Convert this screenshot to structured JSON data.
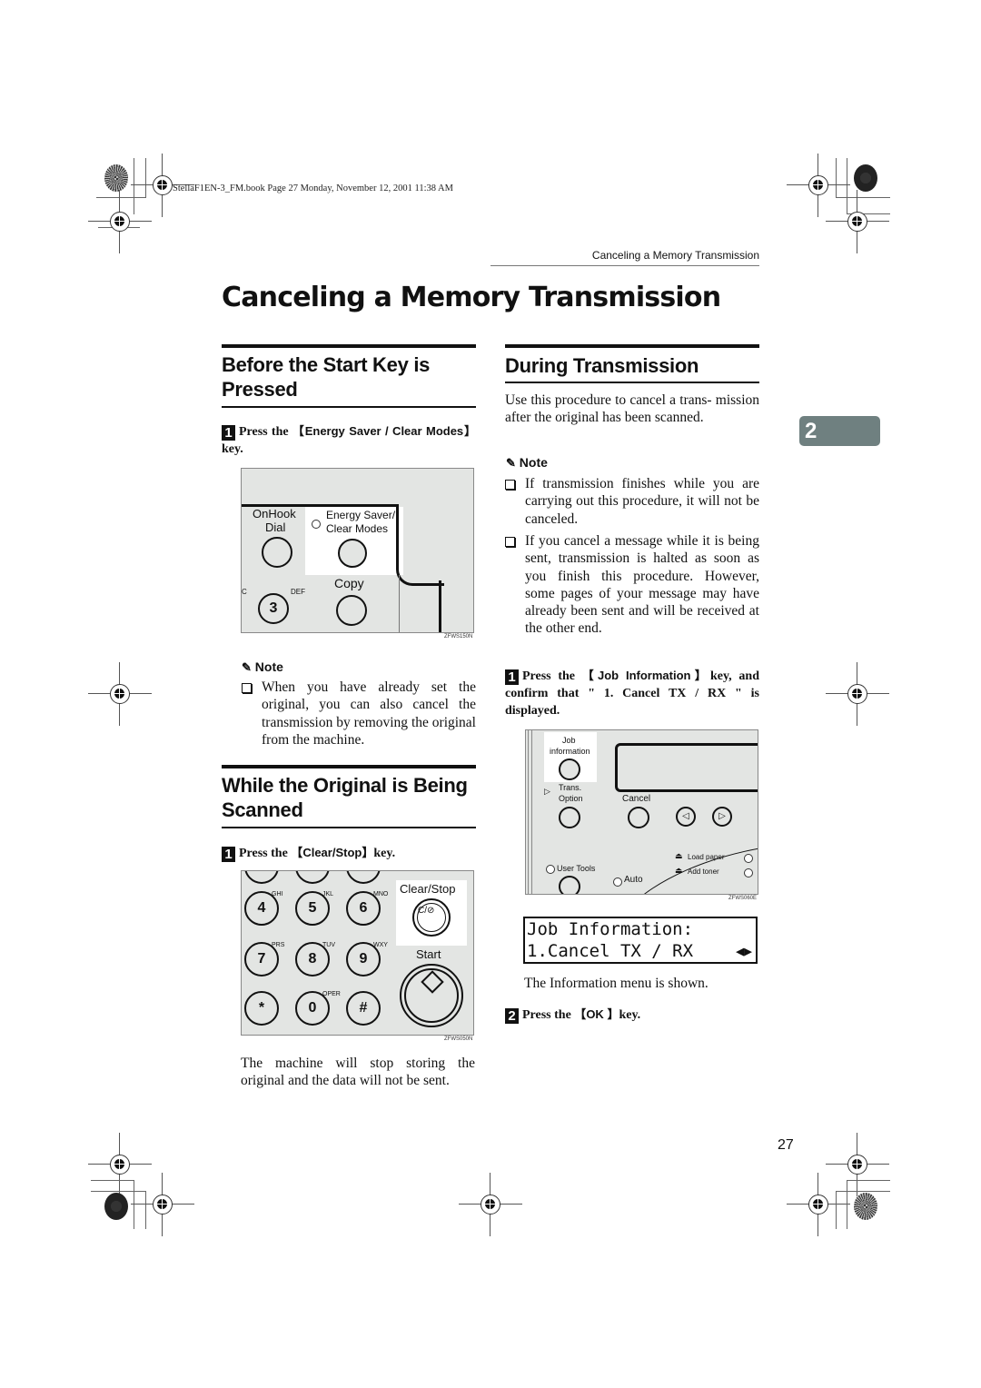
{
  "print_header": "StellaF1EN-3_FM.book  Page 27  Monday, November 12, 2001  11:38 AM",
  "running_head": "Canceling a Memory Transmission",
  "page_title": "Canceling a Memory Transmission",
  "chapter_tab": "2",
  "page_number": "27",
  "left_column": {
    "section1": {
      "title_line1": "Before the Start Key is",
      "title_line2": "Pressed",
      "step1": {
        "num": "1",
        "prefix": "Press the ",
        "key_open": "【",
        "key": "Energy Saver / Clear Modes",
        "key_close": "】",
        "suffix": "key."
      },
      "figure": {
        "labels": {
          "onhook": "OnHook",
          "dial": "Dial",
          "energy1": "Energy Saver/",
          "energy2": "Clear Modes",
          "copy": "Copy",
          "abc_frag": "C",
          "def": "DEF",
          "key3": "3"
        },
        "figure_id": "ZFWS150N"
      },
      "note": {
        "heading": "Note",
        "items": [
          "When you have already set the original, you can also cancel the transmission by removing the original from the machine."
        ]
      }
    },
    "section2": {
      "title_line1": "While the Original is Being",
      "title_line2": "Scanned",
      "step1": {
        "num": "1",
        "prefix": "Press the ",
        "key_open": "【",
        "key": "Clear/Stop",
        "key_close": "】",
        "suffix": "key."
      },
      "figure": {
        "keys": [
          {
            "digit": "4",
            "letters": "GHI"
          },
          {
            "digit": "5",
            "letters": "JKL"
          },
          {
            "digit": "6",
            "letters": "MNO"
          },
          {
            "digit": "7",
            "letters": "PRS"
          },
          {
            "digit": "8",
            "letters": "TUV"
          },
          {
            "digit": "9",
            "letters": "WXY"
          },
          {
            "digit": "*",
            "letters": ""
          },
          {
            "digit": "0",
            "letters": "OPER"
          },
          {
            "digit": "#",
            "letters": ""
          }
        ],
        "clear_stop_label": "Clear/Stop",
        "clear_stop_glyph": "C/⊘",
        "start_label": "Start",
        "figure_id": "ZFWS050N"
      },
      "result_text": "The machine will stop storing the original and the data will not be sent."
    }
  },
  "right_column": {
    "section": {
      "title": "During Transmission",
      "intro": "Use this procedure to cancel a transmission after the original has been scanned.",
      "intro_display": "Use this procedure to cancel a trans- mission after the original has been scanned.",
      "note": {
        "heading": "Note",
        "items": [
          "If transmission finishes while you are carrying out this procedure, it will not be canceled.",
          "If you cancel a message while it is being sent, transmission is halted as soon as you finish this procedure. However, some pages of your message may have already been sent and will be received at the other end."
        ]
      },
      "step1": {
        "num": "1",
        "prefix": "Press the ",
        "key_open": "【",
        "key": "Job Information",
        "key_close": "】",
        "suffix": "key, and confirm that \" 1. Cancel TX / RX \" is displayed."
      },
      "figure": {
        "labels": {
          "job1": "Job",
          "job2": "information",
          "trans1": "Trans.",
          "trans2": "Option",
          "cancel": "Cancel",
          "user_tools": "User Tools",
          "auto": "Auto",
          "load_paper": "Load paper",
          "add_toner": "Add toner"
        },
        "figure_id": "ZFWS060E"
      },
      "lcd": {
        "line1": "Job Information:",
        "line2": "1.Cancel TX / RX",
        "arrows": "◀▶"
      },
      "lcd_caption": "The Information menu is shown.",
      "step2": {
        "num": "2",
        "prefix": "Press the ",
        "key_open": "【",
        "key": "OK ",
        "key_close": "】",
        "suffix": "key."
      }
    }
  }
}
